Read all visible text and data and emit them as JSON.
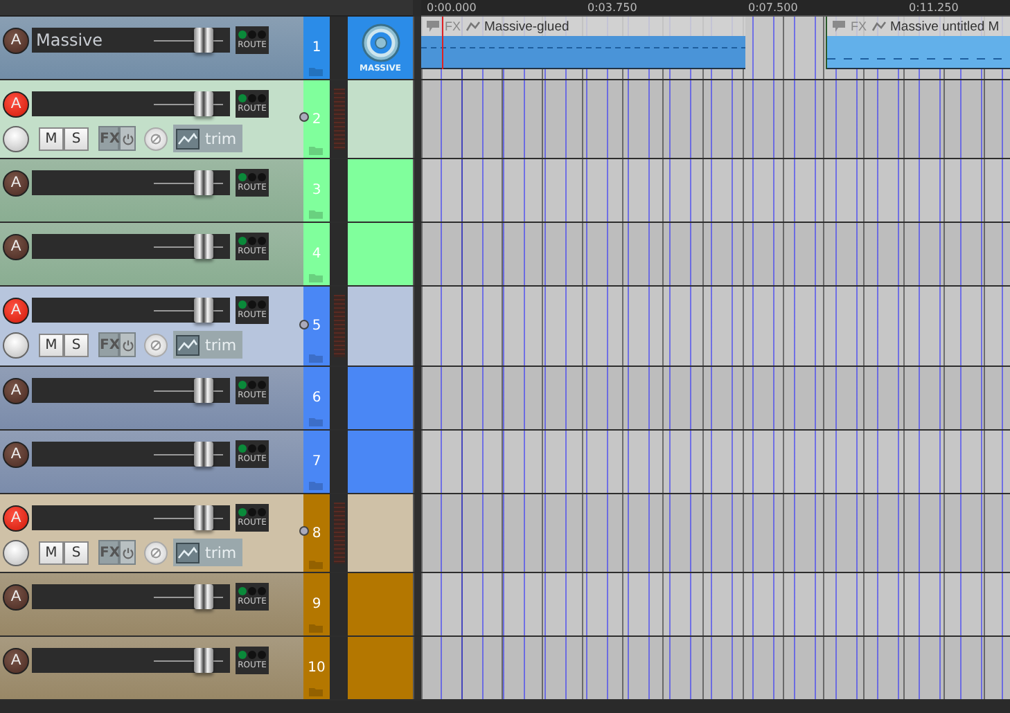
{
  "ruler": {
    "labels": [
      "0:00.000",
      "0:03.750",
      "0:07.500",
      "0:11.250"
    ]
  },
  "tracks": [
    {
      "number": "1",
      "name": "Massive",
      "color": "#2b8ce8",
      "arm_label": "A",
      "armed": false,
      "expanded": false,
      "folder": false,
      "level": 0.72,
      "route_label": "ROUTE",
      "instrument_label": "MASSIVE",
      "items": [
        {
          "name": "Massive-glued",
          "fx_label": "FX"
        },
        {
          "name": "Massive untitled M",
          "fx_label": "FX"
        }
      ]
    },
    {
      "number": "2",
      "color": "#80ff9c",
      "arm_label": "A",
      "armed": true,
      "expanded": true,
      "folder": true,
      "level": 0.72,
      "route_label": "ROUTE",
      "controls": {
        "mute": "M",
        "solo": "S",
        "fx": "FX",
        "trim": "trim"
      }
    },
    {
      "number": "3",
      "color": "#80ff9c",
      "arm_label": "A",
      "armed": false,
      "expanded": false,
      "folder": false,
      "level": 0.72,
      "route_label": "ROUTE"
    },
    {
      "number": "4",
      "color": "#80ff9c",
      "arm_label": "A",
      "armed": false,
      "expanded": false,
      "folder": false,
      "level": 0.72,
      "route_label": "ROUTE"
    },
    {
      "number": "5",
      "color": "#4a87f5",
      "arm_label": "A",
      "armed": true,
      "expanded": true,
      "folder": true,
      "level": 0.72,
      "route_label": "ROUTE",
      "controls": {
        "mute": "M",
        "solo": "S",
        "fx": "FX",
        "trim": "trim"
      }
    },
    {
      "number": "6",
      "color": "#4a87f5",
      "arm_label": "A",
      "armed": false,
      "expanded": false,
      "folder": false,
      "level": 0.72,
      "route_label": "ROUTE"
    },
    {
      "number": "7",
      "color": "#4a87f5",
      "arm_label": "A",
      "armed": false,
      "expanded": false,
      "folder": false,
      "level": 0.72,
      "route_label": "ROUTE"
    },
    {
      "number": "8",
      "color": "#b47700",
      "arm_label": "A",
      "armed": true,
      "expanded": true,
      "folder": true,
      "level": 0.72,
      "route_label": "ROUTE",
      "controls": {
        "mute": "M",
        "solo": "S",
        "fx": "FX",
        "trim": "trim"
      }
    },
    {
      "number": "9",
      "color": "#b47700",
      "arm_label": "A",
      "armed": false,
      "expanded": false,
      "folder": false,
      "level": 0.72,
      "route_label": "ROUTE"
    },
    {
      "number": "10",
      "color": "#b47700",
      "arm_label": "A",
      "armed": false,
      "expanded": false,
      "folder": false,
      "level": 0.72,
      "route_label": "ROUTE"
    }
  ]
}
